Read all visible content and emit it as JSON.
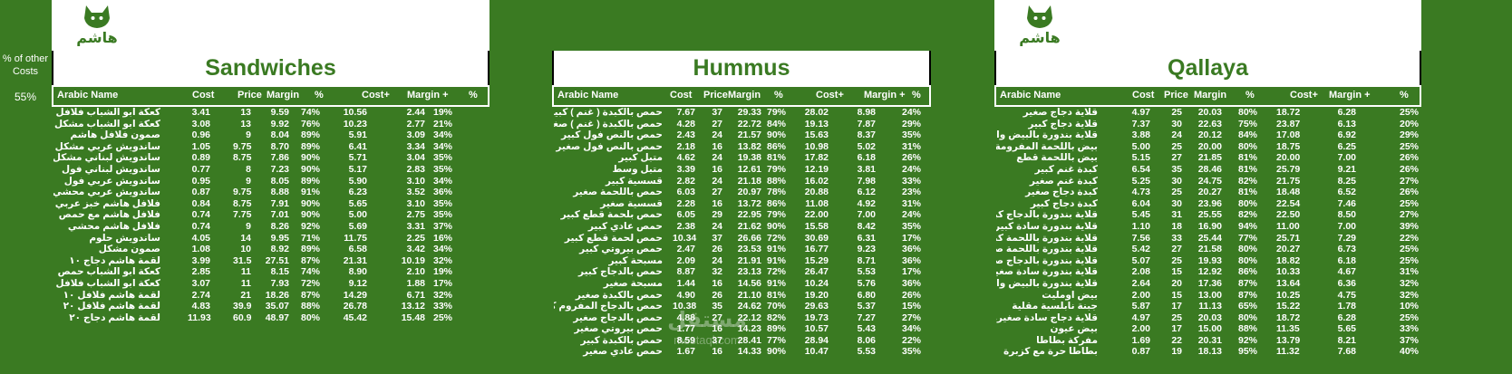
{
  "brand": {
    "logo_text": "هاشم"
  },
  "other_costs": {
    "label_line1": "% of other",
    "label_line2": "Costs",
    "value": "55%"
  },
  "watermark": {
    "line1": "مستقل",
    "line2": "mostaql.com"
  },
  "colors": {
    "background": "#3a7a22",
    "title": "#3a7a22",
    "text": "#ffffff"
  },
  "sandwiches": {
    "title": "Sandwiches",
    "headers": [
      "Arabic Name",
      "Cost",
      "Price",
      "Margin",
      "%",
      "Cost+",
      "Margin +",
      "%"
    ],
    "rows": [
      [
        "كعكة ابو الشباب فلافل محتشي مشكل",
        "3.41",
        "13",
        "9.59",
        "74%",
        "10.56",
        "2.44",
        "19%"
      ],
      [
        "كعكة ابو الشباب مشكل",
        "3.08",
        "13",
        "9.92",
        "76%",
        "10.23",
        "2.77",
        "21%"
      ],
      [
        "صمون فلافل هاشم",
        "0.96",
        "9",
        "8.04",
        "89%",
        "5.91",
        "3.09",
        "34%"
      ],
      [
        "ساندويش عربي مشكل",
        "1.05",
        "9.75",
        "8.70",
        "89%",
        "6.41",
        "3.34",
        "34%"
      ],
      [
        "ساندويش لبناني مشكل",
        "0.89",
        "8.75",
        "7.86",
        "90%",
        "5.71",
        "3.04",
        "35%"
      ],
      [
        "ساندويش لبناني فول",
        "0.77",
        "8",
        "7.23",
        "90%",
        "5.17",
        "2.83",
        "35%"
      ],
      [
        "ساندويش عربي فول",
        "0.95",
        "9",
        "8.05",
        "89%",
        "5.90",
        "3.10",
        "34%"
      ],
      [
        "ساندويش عربي محشي",
        "0.87",
        "9.75",
        "8.88",
        "91%",
        "6.23",
        "3.52",
        "36%"
      ],
      [
        "فلافل هاشم خبز عربي",
        "0.84",
        "8.75",
        "7.91",
        "90%",
        "5.65",
        "3.10",
        "35%"
      ],
      [
        "فلافل هاشم مع حمص",
        "0.74",
        "7.75",
        "7.01",
        "90%",
        "5.00",
        "2.75",
        "35%"
      ],
      [
        "فلافل هاشم محشي",
        "0.74",
        "9",
        "8.26",
        "92%",
        "5.69",
        "3.31",
        "37%"
      ],
      [
        "ساندويش حلوم",
        "4.05",
        "14",
        "9.95",
        "71%",
        "11.75",
        "2.25",
        "16%"
      ],
      [
        "صمون مشكل",
        "1.08",
        "10",
        "8.92",
        "89%",
        "6.58",
        "3.42",
        "34%"
      ],
      [
        "لقمة هاشم دجاج ١٠",
        "3.99",
        "31.5",
        "27.51",
        "87%",
        "21.31",
        "10.19",
        "32%"
      ],
      [
        "كعكة ابو الشباب حمص",
        "2.85",
        "11",
        "8.15",
        "74%",
        "8.90",
        "2.10",
        "19%"
      ],
      [
        "كعكة ابو الشباب فلافل محشي",
        "3.07",
        "11",
        "7.93",
        "72%",
        "9.12",
        "1.88",
        "17%"
      ],
      [
        "لقمة هاشم فلافل ١٠",
        "2.74",
        "21",
        "18.26",
        "87%",
        "14.29",
        "6.71",
        "32%"
      ],
      [
        "لقمة هاشم فلافل ٢٠",
        "4.83",
        "39.9",
        "35.07",
        "88%",
        "26.78",
        "13.12",
        "33%"
      ],
      [
        "لقمة هاشم دجاج ٢٠",
        "11.93",
        "60.9",
        "48.97",
        "80%",
        "45.42",
        "15.48",
        "25%"
      ]
    ]
  },
  "hummus": {
    "title": "Hummus",
    "headers": [
      "Arabic Name",
      "Cost",
      "Price",
      "Margin",
      "%",
      "Cost+",
      "Margin +",
      "%"
    ],
    "rows": [
      [
        "حمص بالكبدة ( غنم ) كبير",
        "7.67",
        "37",
        "29.33",
        "79%",
        "28.02",
        "8.98",
        "24%"
      ],
      [
        "حمص بالكبدة ( غنم ) صغير",
        "4.28",
        "27",
        "22.72",
        "84%",
        "19.13",
        "7.87",
        "29%"
      ],
      [
        "حمص بالنص فول كبير",
        "2.43",
        "24",
        "21.57",
        "90%",
        "15.63",
        "8.37",
        "35%"
      ],
      [
        "حمص بالنص فول صغير",
        "2.18",
        "16",
        "13.82",
        "86%",
        "10.98",
        "5.02",
        "31%"
      ],
      [
        "متبل كبير",
        "4.62",
        "24",
        "19.38",
        "81%",
        "17.82",
        "6.18",
        "26%"
      ],
      [
        "متبل وسط",
        "3.39",
        "16",
        "12.61",
        "79%",
        "12.19",
        "3.81",
        "24%"
      ],
      [
        "قسسية كبير",
        "2.82",
        "24",
        "21.18",
        "88%",
        "16.02",
        "7.98",
        "33%"
      ],
      [
        "حمص باللحمة صغير",
        "6.03",
        "27",
        "20.97",
        "78%",
        "20.88",
        "6.12",
        "23%"
      ],
      [
        "قسسية صغير",
        "2.28",
        "16",
        "13.72",
        "86%",
        "11.08",
        "4.92",
        "31%"
      ],
      [
        "حمص بلحمة قطع كبير",
        "6.05",
        "29",
        "22.95",
        "79%",
        "22.00",
        "7.00",
        "24%"
      ],
      [
        "حمص عادي كبير",
        "2.38",
        "24",
        "21.62",
        "90%",
        "15.58",
        "8.42",
        "35%"
      ],
      [
        "حمص لحمة قطع كبير",
        "10.34",
        "37",
        "26.66",
        "72%",
        "30.69",
        "6.31",
        "17%"
      ],
      [
        "حمص بيروتي كبير",
        "2.47",
        "26",
        "23.53",
        "91%",
        "16.77",
        "9.23",
        "36%"
      ],
      [
        "مسبحة كبير",
        "2.09",
        "24",
        "21.91",
        "91%",
        "15.29",
        "8.71",
        "36%"
      ],
      [
        "حمص بالدجاج كبير",
        "8.87",
        "32",
        "23.13",
        "72%",
        "26.47",
        "5.53",
        "17%"
      ],
      [
        "مسبحة صغير",
        "1.44",
        "16",
        "14.56",
        "91%",
        "10.24",
        "5.76",
        "36%"
      ],
      [
        "حمص بالكبدة صغير",
        "4.90",
        "26",
        "21.10",
        "81%",
        "19.20",
        "6.80",
        "26%"
      ],
      [
        "حمص بالدجاج المفروم كبير",
        "10.38",
        "35",
        "24.62",
        "70%",
        "29.63",
        "5.37",
        "15%"
      ],
      [
        "حمص بالدجاج صغير",
        "4.88",
        "27",
        "22.12",
        "82%",
        "19.73",
        "7.27",
        "27%"
      ],
      [
        "حمص بيروتي صغير",
        "1.77",
        "16",
        "14.23",
        "89%",
        "10.57",
        "5.43",
        "34%"
      ],
      [
        "حمص بالكبدة كبير",
        "8.59",
        "37",
        "28.41",
        "77%",
        "28.94",
        "8.06",
        "22%"
      ],
      [
        "حمص عادي صغير",
        "1.67",
        "16",
        "14.33",
        "90%",
        "10.47",
        "5.53",
        "35%"
      ]
    ]
  },
  "qallaya": {
    "title": "Qallaya",
    "headers": [
      "Arabic Name",
      "Cost",
      "Price",
      "Margin",
      "%",
      "Cost+",
      "Margin +",
      "%"
    ],
    "rows": [
      [
        "قلاية دجاج صغير",
        "4.97",
        "25",
        "20.03",
        "80%",
        "18.72",
        "6.28",
        "25%"
      ],
      [
        "قلاية دجاج كبير",
        "7.37",
        "30",
        "22.63",
        "75%",
        "23.87",
        "6.13",
        "20%"
      ],
      [
        "قلاية بندورة بالبيض والجبنة كبير",
        "3.88",
        "24",
        "20.12",
        "84%",
        "17.08",
        "6.92",
        "29%"
      ],
      [
        "بيض باللحمة المفرومة",
        "5.00",
        "25",
        "20.00",
        "80%",
        "18.75",
        "6.25",
        "25%"
      ],
      [
        "بيض باللحمة قطع",
        "5.15",
        "27",
        "21.85",
        "81%",
        "20.00",
        "7.00",
        "26%"
      ],
      [
        "كبدة غنم كبير",
        "6.54",
        "35",
        "28.46",
        "81%",
        "25.79",
        "9.21",
        "26%"
      ],
      [
        "كبدة غنم صغير",
        "5.25",
        "30",
        "24.75",
        "82%",
        "21.75",
        "8.25",
        "27%"
      ],
      [
        "كبدة دجاج صغير",
        "4.73",
        "25",
        "20.27",
        "81%",
        "18.48",
        "6.52",
        "26%"
      ],
      [
        "كبدة دجاج كبير",
        "6.04",
        "30",
        "23.96",
        "80%",
        "22.54",
        "7.46",
        "25%"
      ],
      [
        "قلاية بندورة بالدجاج كبير",
        "5.45",
        "31",
        "25.55",
        "82%",
        "22.50",
        "8.50",
        "27%"
      ],
      [
        "قلاية بندورة سادة كبير",
        "1.10",
        "18",
        "16.90",
        "94%",
        "11.00",
        "7.00",
        "39%"
      ],
      [
        "قلاية بندورة باللحمة كبير",
        "7.56",
        "33",
        "25.44",
        "77%",
        "25.71",
        "7.29",
        "22%"
      ],
      [
        "قلاية بندورة باللحمة صغير",
        "5.42",
        "27",
        "21.58",
        "80%",
        "20.27",
        "6.73",
        "25%"
      ],
      [
        "قلاية بندورة بالدجاج صغير",
        "5.07",
        "25",
        "19.93",
        "80%",
        "18.82",
        "6.18",
        "25%"
      ],
      [
        "قلاية بندورة سادة صغير",
        "2.08",
        "15",
        "12.92",
        "86%",
        "10.33",
        "4.67",
        "31%"
      ],
      [
        "قلاية بندورة بالبيض والجبنة صغير",
        "2.64",
        "20",
        "17.36",
        "87%",
        "13.64",
        "6.36",
        "32%"
      ],
      [
        "بيض اومليت",
        "2.00",
        "15",
        "13.00",
        "87%",
        "10.25",
        "4.75",
        "32%"
      ],
      [
        "جبنة نابلسية مقلية",
        "5.87",
        "17",
        "11.13",
        "65%",
        "15.22",
        "1.78",
        "10%"
      ],
      [
        "قلاية دجاج سادة صغيرة",
        "4.97",
        "25",
        "20.03",
        "80%",
        "18.72",
        "6.28",
        "25%"
      ],
      [
        "بيض عيون",
        "2.00",
        "17",
        "15.00",
        "88%",
        "11.35",
        "5.65",
        "33%"
      ],
      [
        "مفركة بطاطا",
        "1.69",
        "22",
        "20.31",
        "92%",
        "13.79",
        "8.21",
        "37%"
      ],
      [
        "بطاطا حرة مع كزبرة",
        "0.87",
        "19",
        "18.13",
        "95%",
        "11.32",
        "7.68",
        "40%"
      ]
    ]
  }
}
